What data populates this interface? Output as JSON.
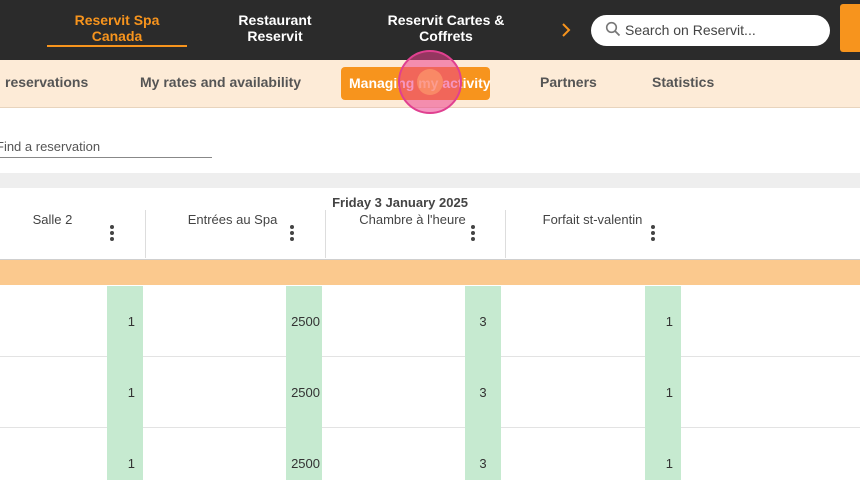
{
  "topbar": {
    "tabs": [
      {
        "label": "Reservit Spa\nCanada",
        "line1": "Reservit Spa",
        "line2": "Canada"
      },
      {
        "label": "Restaurant Reservit",
        "line1": "Restaurant",
        "line2": "Reservit"
      },
      {
        "label": "Reservit Cartes & Coffrets",
        "line1": "Reservit Cartes &",
        "line2": "Coffrets"
      }
    ],
    "active_tab": "Reservit Spa Canada",
    "search_placeholder": "Search on Reservit...",
    "chevron_icon": "chevron-right-icon",
    "accent_color": "#f7941d"
  },
  "subnav": {
    "tabs": [
      {
        "label": "reservations"
      },
      {
        "label": "My rates and availability"
      },
      {
        "label": "Managing my activity"
      },
      {
        "label": "Partners"
      },
      {
        "label": "Statistics"
      }
    ],
    "active_tab": "Managing my activity"
  },
  "find": {
    "placeholder": "Find a reservation"
  },
  "table": {
    "date_title": "Friday 3 January 2025",
    "columns": [
      {
        "label": "Salle 2"
      },
      {
        "label": "Entrées au Spa"
      },
      {
        "label": "Chambre à l'heure"
      },
      {
        "label": "Forfait st-valentin"
      }
    ],
    "rows": [
      [
        "1",
        "2500",
        "3",
        "1"
      ],
      [
        "1",
        "2500",
        "3",
        "1"
      ],
      [
        "1",
        "2500",
        "3",
        "1"
      ]
    ],
    "cell_color": "#c6ead0",
    "band_color": "#fbc98e"
  }
}
